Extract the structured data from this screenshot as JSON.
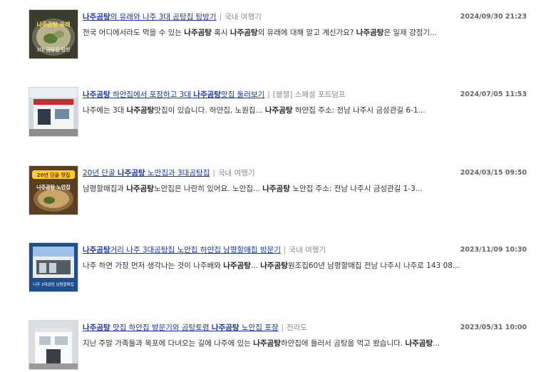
{
  "results": [
    {
      "title": [
        {
          "t": "나주곰탕",
          "b": true
        },
        {
          "t": "의 유래와 나주 3대 곰탕집 탐방기",
          "b": false
        }
      ],
      "category": "국내 여행기",
      "date": "2024/09/30 21:23",
      "snippet": [
        {
          "t": "전국 어디에서라도 먹을 수 있는 ",
          "b": false
        },
        {
          "t": "나주곰탕",
          "b": true
        },
        {
          "t": " 혹시 ",
          "b": false
        },
        {
          "t": "나주곰탕",
          "b": true
        },
        {
          "t": "의 유래에 대해 알고 계신가요? ",
          "b": false
        },
        {
          "t": "나주곰탕",
          "b": true
        },
        {
          "t": "은 일제 강점기...",
          "b": false
        }
      ],
      "thumb_text": [
        "나주곰탕 유래",
        "3대 곰탕집 탐방"
      ]
    },
    {
      "title": [
        {
          "t": "나주곰탕",
          "b": true
        },
        {
          "t": " 하얀집에서 포장하고 3대 ",
          "b": false
        },
        {
          "t": "나주곰탕",
          "b": true
        },
        {
          "t": "맛집 둘러보기",
          "b": false
        }
      ],
      "category": "[블챌] 스페셜 포트덤프",
      "date": "2024/07/05 11:53",
      "snippet": [
        {
          "t": "나주에는 3대 ",
          "b": false
        },
        {
          "t": "나주곰탕",
          "b": true
        },
        {
          "t": "맛집이 있습니다. 하얀집, 노원집... ",
          "b": false
        },
        {
          "t": "나주곰탕",
          "b": true
        },
        {
          "t": " 하얀집 주소: 전남 나주시 금성관길 6-1...",
          "b": false
        }
      ],
      "thumb_text": []
    },
    {
      "title": [
        {
          "t": "20년 단골 ",
          "b": false
        },
        {
          "t": "나주곰탕",
          "b": true
        },
        {
          "t": " 노안집과 3대곰탕집",
          "b": false
        }
      ],
      "category": "국내 여행기",
      "date": "2024/03/15 09:50",
      "snippet": [
        {
          "t": "남평할매집과 ",
          "b": false
        },
        {
          "t": "나주곰탕",
          "b": true
        },
        {
          "t": "노안집은 나란히 있어요. 노안집... ",
          "b": false
        },
        {
          "t": "나주곰탕",
          "b": true
        },
        {
          "t": " 노안집 주소: 전남 나주시 금성관길 1-3...",
          "b": false
        }
      ],
      "thumb_text": [
        "20년 단골 맛집",
        "나주곰탕 노안집"
      ]
    },
    {
      "title": [
        {
          "t": "나주곰탕",
          "b": true
        },
        {
          "t": "거리 나주 3대곰탕집 노안집 하얀집 남평할매집 방문기",
          "b": false
        }
      ],
      "category": "국내 여행기",
      "date": "2023/11/09 10:30",
      "snippet": [
        {
          "t": "나주 하면 가장 먼저 생각나는 것이 나주배와 ",
          "b": false
        },
        {
          "t": "나주곰탕",
          "b": true
        },
        {
          "t": "... ",
          "b": false
        },
        {
          "t": "나주곰탕",
          "b": true
        },
        {
          "t": "원조집60년 남평할매집 전남 나주시 나주로 143 08...",
          "b": false
        }
      ],
      "thumb_text": [
        "나주 3대곰탕 남평할매집"
      ]
    },
    {
      "title": [
        {
          "t": "나주곰탕",
          "b": true
        },
        {
          "t": " 맛집 하얀집 방문기와 곰탕토렴 ",
          "b": false
        },
        {
          "t": "나주곰탕",
          "b": true
        },
        {
          "t": " 노안집 포장",
          "b": false
        }
      ],
      "category": "전라도",
      "date": "2023/05/31 10:00",
      "snippet": [
        {
          "t": "지난 주말 가족들과 목포에 다녀오는 길에 나주에 있는 ",
          "b": false
        },
        {
          "t": "나주곰탕",
          "b": true
        },
        {
          "t": "하얀집에 들러서 곰탕을 먹고 왔습니다. ",
          "b": false
        },
        {
          "t": "나주곰탕",
          "b": true
        },
        {
          "t": "...",
          "b": false
        }
      ],
      "thumb_text": []
    }
  ],
  "colors": {
    "link": "#1a35a8",
    "category": "#8a8a8a",
    "date": "#666666"
  }
}
